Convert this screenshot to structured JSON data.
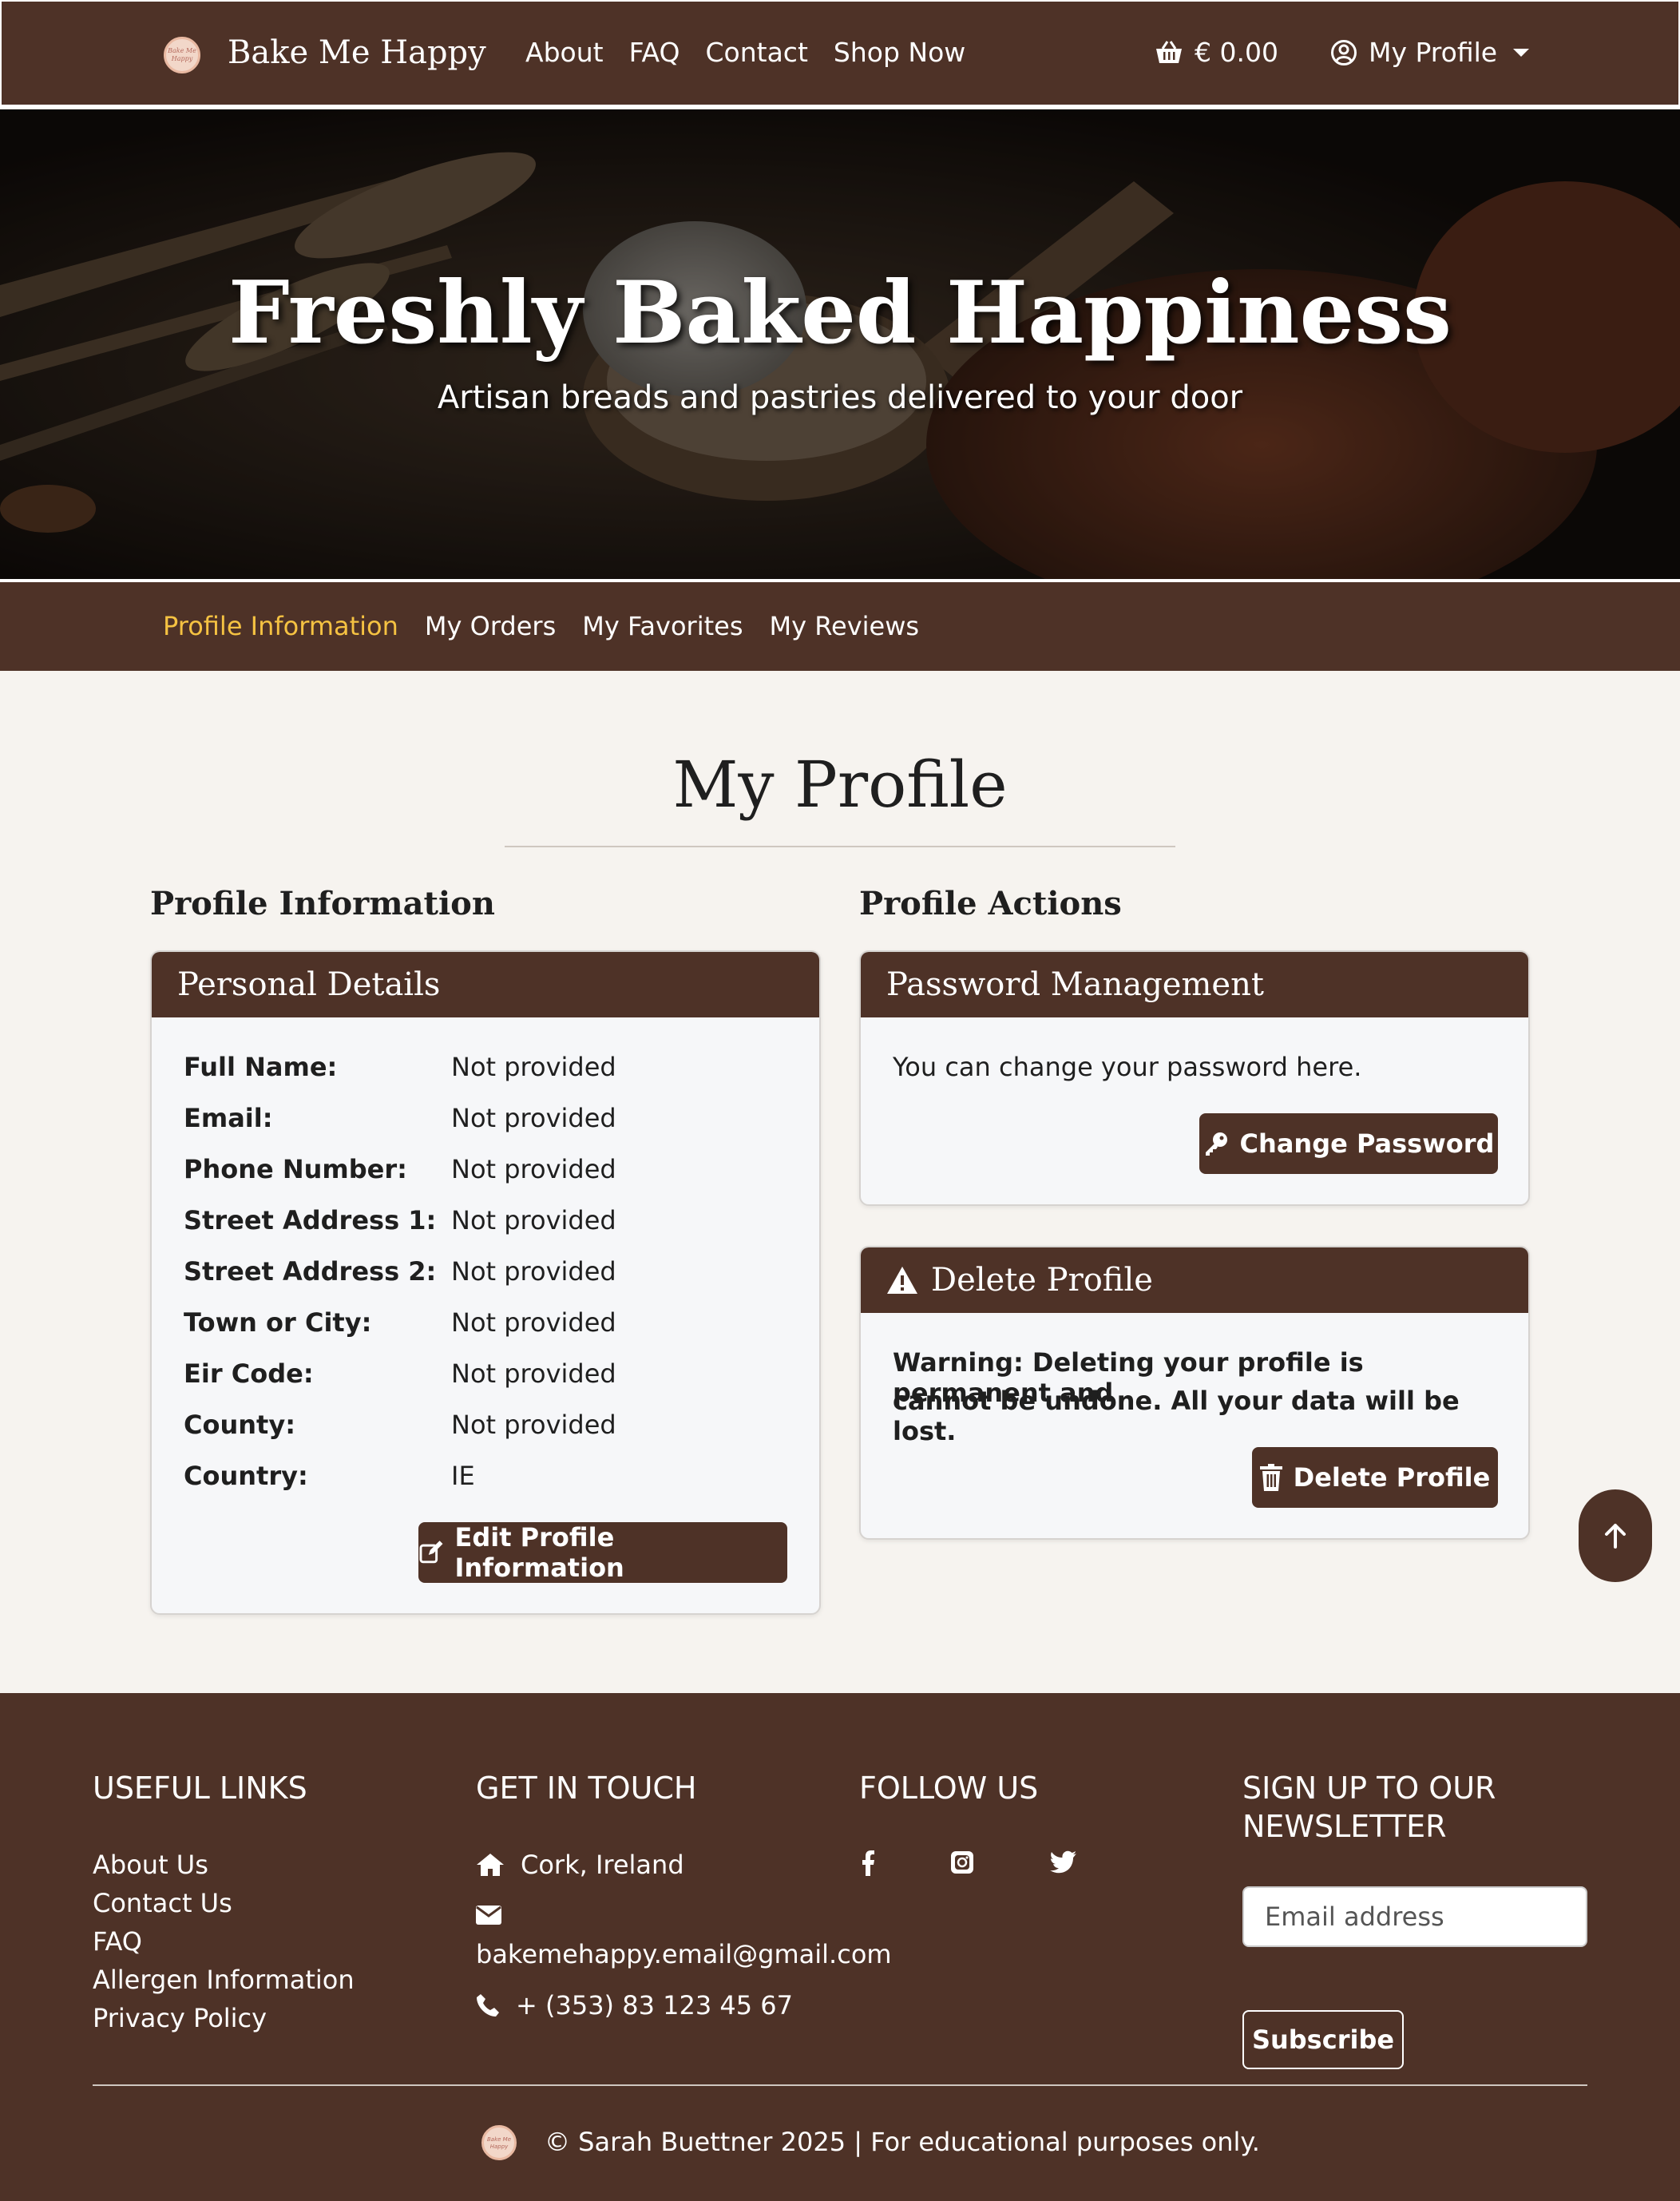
{
  "nav": {
    "brand": "Bake Me Happy",
    "logo_text": "Bake Me Happy",
    "links": [
      "About",
      "FAQ",
      "Contact",
      "Shop Now"
    ],
    "cart_total": "€ 0.00",
    "profile_label": "My Profile"
  },
  "hero": {
    "title": "Freshly Baked Happiness",
    "subtitle": "Artisan breads and pastries delivered to your door"
  },
  "subnav": {
    "items": [
      "Profile Information",
      "My Orders",
      "My Favorites",
      "My Reviews"
    ],
    "active": "Profile Information"
  },
  "main": {
    "page_title": "My Profile",
    "left_heading": "Profile Information",
    "right_heading": "Profile Actions",
    "personal": {
      "header": "Personal Details",
      "rows": [
        {
          "label": "Full Name:",
          "value": "Not provided"
        },
        {
          "label": "Email:",
          "value": "Not provided"
        },
        {
          "label": "Phone Number:",
          "value": "Not provided"
        },
        {
          "label": "Street Address 1:",
          "value": "Not provided"
        },
        {
          "label": "Street Address 2:",
          "value": "Not provided"
        },
        {
          "label": "Town or City:",
          "value": "Not provided"
        },
        {
          "label": "Eir Code:",
          "value": "Not provided"
        },
        {
          "label": "County:",
          "value": "Not provided"
        },
        {
          "label": "Country:",
          "value": "IE"
        }
      ],
      "edit_button": "Edit Profile Information"
    },
    "password": {
      "header": "Password Management",
      "text": "You can change your password here.",
      "button": "Change Password"
    },
    "delete": {
      "header": "Delete Profile",
      "warning_line1": "Warning: Deleting your profile is permanent and",
      "warning_line2": "cannot be undone. All your data will be lost.",
      "button": "Delete Profile"
    }
  },
  "footer": {
    "useful_links_heading": "USEFUL LINKS",
    "useful_links": [
      "About Us",
      "Contact Us",
      "FAQ",
      "Allergen Information",
      "Privacy Policy"
    ],
    "contact_heading": "GET IN TOUCH",
    "location": "Cork, Ireland",
    "email": "bakemehappy.email@gmail.com",
    "phone": "+ (353) 83 123 45 67",
    "follow_heading": "FOLLOW US",
    "newsletter_heading_line1": "SIGN UP TO OUR",
    "newsletter_heading_line2": "NEWSLETTER",
    "email_placeholder": "Email address",
    "subscribe_label": "Subscribe",
    "copyright": "© Sarah Buettner 2025 | For educational purposes only."
  },
  "colors": {
    "brand_brown": "#4e3227",
    "active_link": "#f5c242",
    "page_bg": "#f6f3ef"
  },
  "icons": [
    "basket-icon",
    "user-circle-icon",
    "edit-icon",
    "key-icon",
    "warning-icon",
    "trash-icon",
    "arrow-up-icon",
    "home-icon",
    "envelope-icon",
    "phone-icon",
    "facebook-icon",
    "instagram-icon",
    "twitter-icon"
  ]
}
